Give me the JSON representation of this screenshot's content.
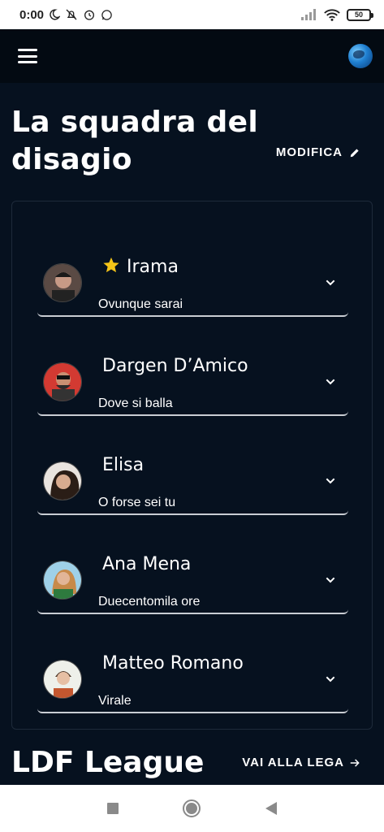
{
  "status_bar": {
    "time": "0:00",
    "icons": [
      "moon-icon",
      "notifications-off-icon",
      "alarm-icon",
      "whatsapp-icon"
    ],
    "right_icons": [
      "signal-icon",
      "wifi-icon"
    ],
    "battery": "50"
  },
  "app_bar": {
    "menu_icon": "hamburger-menu-icon",
    "avatar_icon": "profile-avatar"
  },
  "team": {
    "title": "La squadra del disagio",
    "edit_label": "MODIFICA",
    "edit_icon": "pencil-icon",
    "members": [
      {
        "name": "Irama",
        "song": "Ovunque sarai",
        "captain": true
      },
      {
        "name": "Dargen D’Amico",
        "song": "Dove si balla",
        "captain": false
      },
      {
        "name": "Elisa",
        "song": "O forse sei tu",
        "captain": false
      },
      {
        "name": "Ana Mena",
        "song": "Duecentomila ore",
        "captain": false
      },
      {
        "name": "Matteo Romano",
        "song": "Virale",
        "captain": false
      }
    ]
  },
  "league": {
    "title": "LDF League",
    "link_label": "VAI ALLA LEGA",
    "link_icon": "arrow-right-icon"
  },
  "colors": {
    "background": "#06111f",
    "app_bar": "#030a12",
    "star": "#f5c518",
    "divider": "#c9cdd3"
  },
  "nav_bar": {
    "buttons": [
      "recents-square-icon",
      "home-circle-icon",
      "back-triangle-icon"
    ]
  }
}
